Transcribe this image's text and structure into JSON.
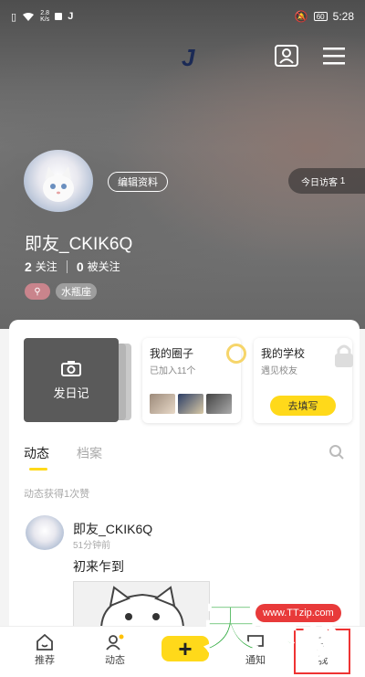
{
  "status_bar": {
    "network_speed": "2.8",
    "network_unit": "K/s",
    "battery": "60",
    "time": "5:28"
  },
  "app": {
    "logo": "J"
  },
  "profile": {
    "edit_label": "编辑资料",
    "visitors_label": "今日访客",
    "visitors_count": "1",
    "username": "即友_CKIK6Q",
    "following_count": "2",
    "following_label": "关注",
    "followers_count": "0",
    "followers_label": "被关注",
    "zodiac": "水瓶座"
  },
  "cards": {
    "diary_label": "发日记",
    "circle": {
      "title": "我的圈子",
      "subtitle": "已加入11个"
    },
    "school": {
      "title": "我的学校",
      "subtitle": "遇见校友",
      "button": "去填写"
    }
  },
  "tabs": [
    {
      "label": "动态"
    },
    {
      "label": "档案"
    }
  ],
  "likes_summary": "动态获得1次赞",
  "post": {
    "author": "即友_CKIK6Q",
    "time": "51分钟前",
    "text": "初来乍到"
  },
  "bottom_nav": [
    {
      "label": "推荐"
    },
    {
      "label": "动态"
    },
    {
      "label": "+"
    },
    {
      "label": "通知"
    },
    {
      "label": "我"
    }
  ],
  "watermark": {
    "url": "www.TTzip.com",
    "text": "天下载"
  },
  "colors": {
    "accent": "#ffd91a",
    "card_dark": "#5a5a5a",
    "tag_pink": "#c9848c"
  }
}
